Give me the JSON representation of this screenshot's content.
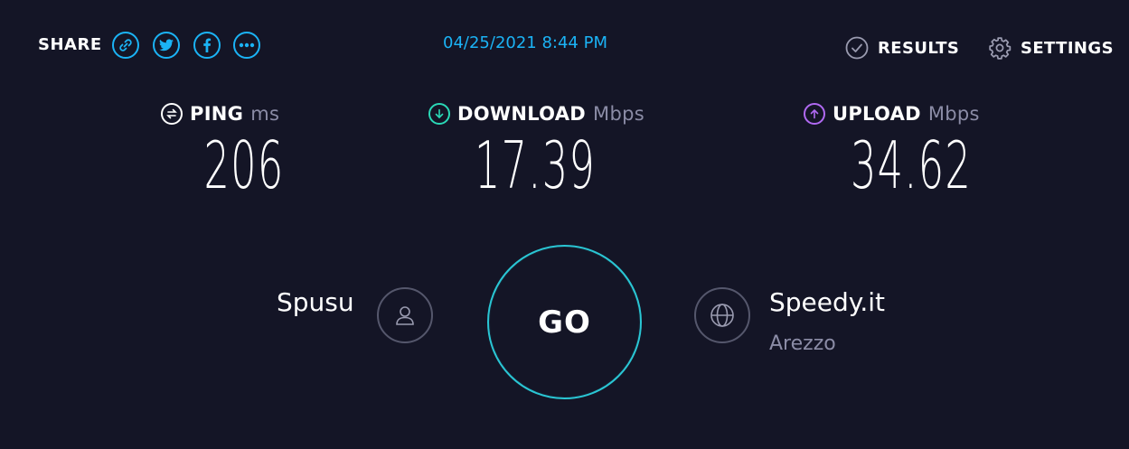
{
  "share": {
    "label": "SHARE",
    "icons": [
      "link-icon",
      "twitter-icon",
      "facebook-icon",
      "more-icon"
    ]
  },
  "timestamp": "04/25/2021 8:44 PM",
  "nav": {
    "results_label": "RESULTS",
    "settings_label": "SETTINGS"
  },
  "metrics": {
    "ping": {
      "label": "PING",
      "unit": "ms",
      "value": "206",
      "icon": "ping-icon",
      "color": "#ffffff"
    },
    "download": {
      "label": "DOWNLOAD",
      "unit": "Mbps",
      "value": "17.39",
      "icon": "download-arrow-icon",
      "color": "#2ad8b6"
    },
    "upload": {
      "label": "UPLOAD",
      "unit": "Mbps",
      "value": "34.62",
      "icon": "upload-arrow-icon",
      "color": "#b069f2"
    }
  },
  "provider": {
    "name": "Spusu",
    "icon": "user-icon"
  },
  "go_label": "GO",
  "server": {
    "name": "Speedy.it",
    "location": "Arezzo",
    "icon": "globe-icon"
  },
  "colors": {
    "background": "#141526",
    "accent": "#1bb3f5",
    "go_ring": "#2ac6d4"
  }
}
